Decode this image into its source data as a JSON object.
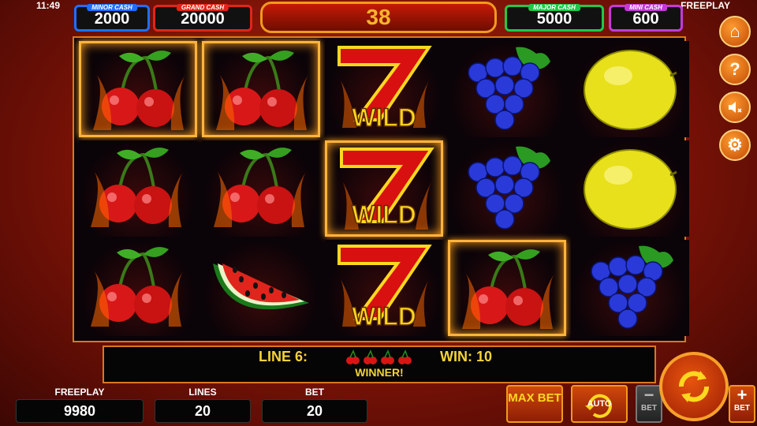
{
  "status": {
    "time": "11:49",
    "mode": "FREEPLAY"
  },
  "jackpots": [
    {
      "label": "MINOR CASH",
      "value": "2000",
      "color": "#1f6fff"
    },
    {
      "label": "GRAND CASH",
      "value": "20000",
      "color": "#e0251a"
    },
    {
      "label": "MAJOR CASH",
      "value": "5000",
      "color": "#1ec84a"
    },
    {
      "label": "MINI CASH",
      "value": "600",
      "color": "#c43ad8"
    }
  ],
  "counter": "38",
  "reels": [
    [
      "cherry-win",
      "cherry",
      "cherry"
    ],
    [
      "cherry-win",
      "cherry",
      "watermelon"
    ],
    [
      "wild",
      "wild-win",
      "wild"
    ],
    [
      "grapes",
      "grapes",
      "cherry-win"
    ],
    [
      "lemon",
      "lemon",
      "grapes"
    ]
  ],
  "wild_text": "WILD",
  "side_buttons": [
    "home-icon",
    "help-icon",
    "sound-muted-icon",
    "settings-icon"
  ],
  "info": {
    "line_label": "LINE 6:",
    "win_label": "WIN: 10",
    "winner_text": "WINNER!"
  },
  "panel": {
    "freeplay_label": "FREEPLAY",
    "freeplay_value": "9980",
    "lines_label": "LINES",
    "lines_value": "20",
    "bet_label": "BET",
    "bet_value": "20"
  },
  "controls": {
    "max_bet": "MAX BET",
    "auto": "AUTO",
    "bet_minus": "BET",
    "bet_plus": "BET"
  }
}
